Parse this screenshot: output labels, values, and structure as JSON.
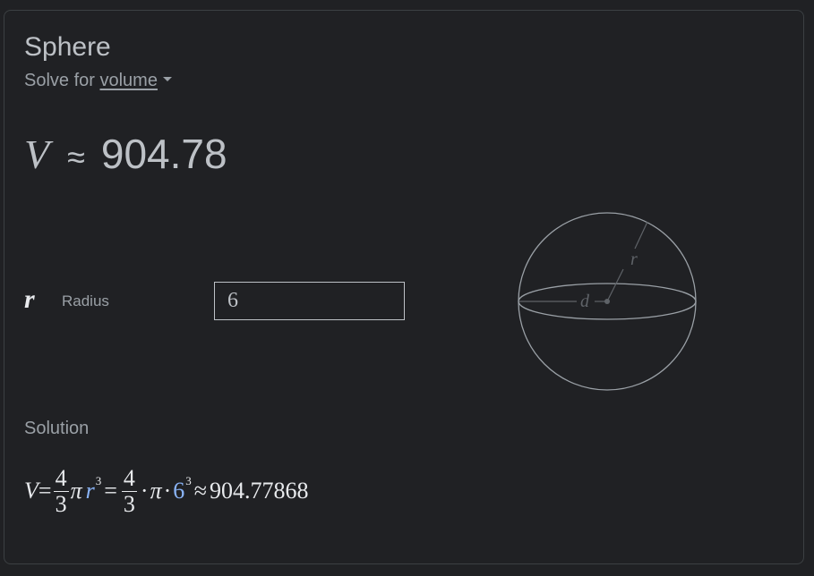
{
  "calculator": {
    "title": "Sphere",
    "solve_for_prefix": "Solve for ",
    "solve_for_value": "volume",
    "result": {
      "variable": "V",
      "approx_symbol": "≈",
      "value": "904.78"
    },
    "parameter": {
      "symbol": "r",
      "label": "Radius",
      "value": "6"
    },
    "diagram": {
      "radius_label": "r",
      "diameter_label": "d"
    },
    "solution": {
      "label": "Solution",
      "lhs": "V",
      "eq": "=",
      "frac_num": "4",
      "frac_den": "3",
      "pi": "π",
      "r": "r",
      "exp": "3",
      "dot": "·",
      "radius_value": "6",
      "approx": "≈",
      "result": "904.77868"
    },
    "colors": {
      "background": "#202124",
      "text": "#bdc1c6",
      "muted": "#9aa0a6",
      "accent": "#8ab4f8"
    }
  }
}
